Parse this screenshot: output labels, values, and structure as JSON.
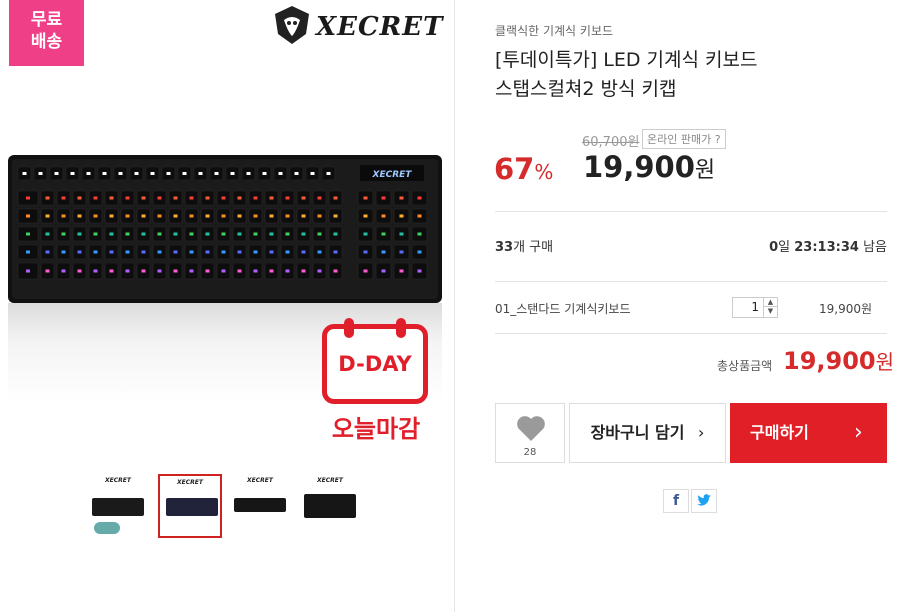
{
  "badge": {
    "line1": "무료",
    "line2": "배송"
  },
  "brand": {
    "name": "XECRET",
    "icon": "brand-logo"
  },
  "promo": {
    "dday": "D-DAY",
    "deadline": "오늘마감"
  },
  "thumbnails": [
    "thumbnail-1",
    "thumbnail-2",
    "thumbnail-3",
    "thumbnail-4"
  ],
  "product": {
    "category": "클랙식한 기계식 키보드",
    "title_line1": "[투데이특가] LED 기계식 키보드",
    "title_line2": "스탭스컬쳐2 방식 키캡",
    "original_price": "60,700원",
    "online_badge": "온라인 판매가 ?",
    "discount_num": "67",
    "discount_unit": "%",
    "price_num": "19,900",
    "price_unit": "원"
  },
  "sales": {
    "sold_count": "33",
    "sold_label": "개 구매",
    "remain_days": "0",
    "remain_days_label": "일",
    "remain_time": "23:13:34",
    "remain_label": "남음"
  },
  "option": {
    "name": "01_스탠다드 기계식키보드",
    "quantity": "1",
    "price": "19,900원"
  },
  "total": {
    "label": "총상품금액",
    "amount": "19,900",
    "unit": "원"
  },
  "actions": {
    "like_count": "28",
    "cart_label": "장바구니 담기",
    "buy_label": "구매하기"
  },
  "share": {
    "facebook": "f",
    "twitter": "t"
  },
  "colors": {
    "accent": "#e11f26",
    "badge": "#ef3f87",
    "discount": "#d62b2b"
  }
}
